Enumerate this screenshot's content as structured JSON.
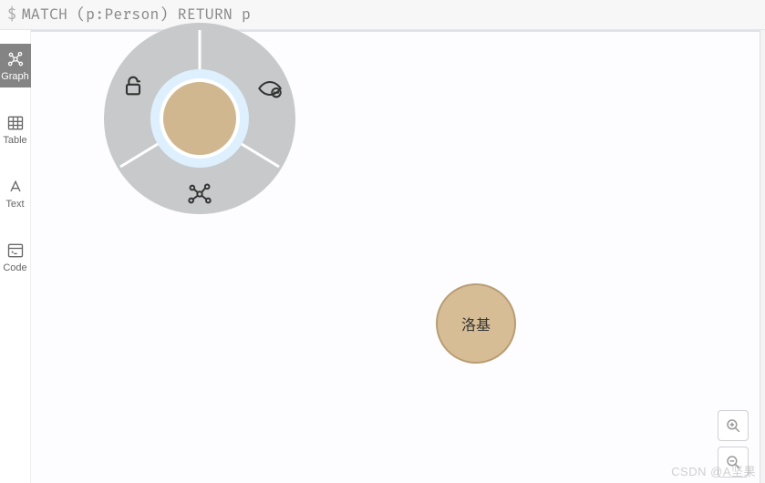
{
  "query": {
    "prompt": "$",
    "text": "MATCH (p:Person) RETURN p"
  },
  "sidebar": {
    "tabs": [
      {
        "id": "graph",
        "label": "Graph",
        "active": true
      },
      {
        "id": "table",
        "label": "Table",
        "active": false
      },
      {
        "id": "text",
        "label": "Text",
        "active": false
      },
      {
        "id": "code",
        "label": "Code",
        "active": false
      }
    ]
  },
  "canvas": {
    "selected_node": {
      "label": "",
      "color": "#d1b78f"
    },
    "nodes": [
      {
        "id": "n2",
        "label": "洛基",
        "color": "#d7bd95"
      }
    ],
    "radial_actions": {
      "unlock": "unlock-icon",
      "hide": "eye-off-icon",
      "expand": "graph-expand-icon"
    }
  },
  "zoom": {
    "in": "+",
    "out": "−"
  },
  "watermark": "CSDN @A坚果"
}
